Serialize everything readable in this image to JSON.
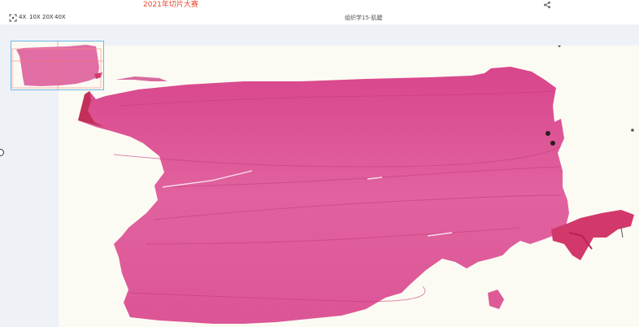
{
  "header": {
    "title": "2021年切片大赛"
  },
  "toolbar": {
    "zoom_levels": [
      "4X",
      "10X",
      "20X",
      "40X"
    ],
    "slide_name": "组织学15-肌腱"
  },
  "icons": {
    "share": "share-icon",
    "fit": "fit-to-screen-icon"
  },
  "colors": {
    "title": "#e8442b",
    "tissue": "#df5a99",
    "tissue_dark": "#c9357a",
    "background_slide": "#fcfbf3",
    "viewer_bg": "#eef2f6",
    "thumbnail_border": "#6fb6e6",
    "crosshair": "#ff6a6a"
  }
}
